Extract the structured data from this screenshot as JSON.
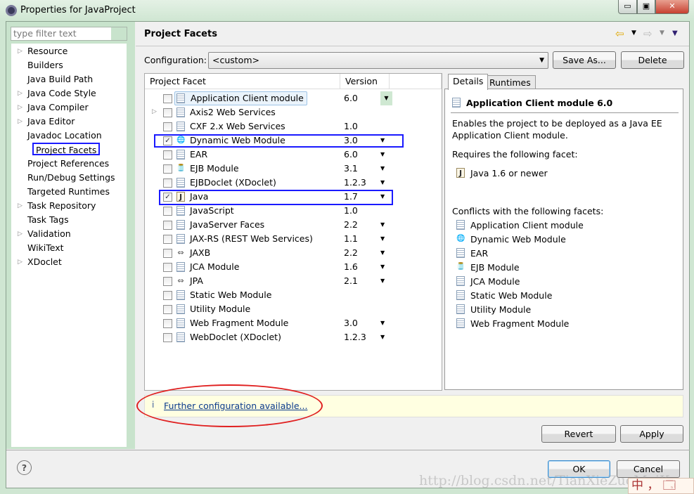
{
  "window": {
    "title": "Properties for JavaProject",
    "minimize": "▭",
    "maximize": "▣",
    "close": "✕"
  },
  "sidebar": {
    "filter_placeholder": "type filter text",
    "items": [
      {
        "label": "Resource",
        "expandable": true
      },
      {
        "label": "Builders",
        "expandable": false
      },
      {
        "label": "Java Build Path",
        "expandable": false
      },
      {
        "label": "Java Code Style",
        "expandable": true
      },
      {
        "label": "Java Compiler",
        "expandable": true
      },
      {
        "label": "Java Editor",
        "expandable": true
      },
      {
        "label": "Javadoc Location",
        "expandable": false
      },
      {
        "label": "Project Facets",
        "expandable": false,
        "selected": true
      },
      {
        "label": "Project References",
        "expandable": false
      },
      {
        "label": "Run/Debug Settings",
        "expandable": false
      },
      {
        "label": "Targeted Runtimes",
        "expandable": false
      },
      {
        "label": "Task Repository",
        "expandable": true
      },
      {
        "label": "Task Tags",
        "expandable": false
      },
      {
        "label": "Validation",
        "expandable": true
      },
      {
        "label": "WikiText",
        "expandable": false
      },
      {
        "label": "XDoclet",
        "expandable": true
      }
    ]
  },
  "page": {
    "title": "Project Facets",
    "config_label": "Configuration:",
    "config_value": "<custom>",
    "save_as": "Save As...",
    "delete": "Delete"
  },
  "table": {
    "headers": [
      "Project Facet",
      "Version"
    ],
    "rows": [
      {
        "name": "Application Client module",
        "version": "6.0",
        "checked": false,
        "icon": "doc",
        "dropdown": true,
        "highlighted": true
      },
      {
        "name": "Axis2 Web Services",
        "version": "",
        "checked": false,
        "icon": "doc",
        "expandable": true
      },
      {
        "name": "CXF 2.x Web Services",
        "version": "1.0",
        "checked": false,
        "icon": "doc"
      },
      {
        "name": "Dynamic Web Module",
        "version": "3.0",
        "checked": true,
        "icon": "globe",
        "dropdown": true
      },
      {
        "name": "EAR",
        "version": "6.0",
        "checked": false,
        "icon": "doc",
        "dropdown": true
      },
      {
        "name": "EJB Module",
        "version": "3.1",
        "checked": false,
        "icon": "jar",
        "dropdown": true
      },
      {
        "name": "EJBDoclet (XDoclet)",
        "version": "1.2.3",
        "checked": false,
        "icon": "doc",
        "dropdown": true
      },
      {
        "name": "Java",
        "version": "1.7",
        "checked": true,
        "icon": "java",
        "dropdown": true
      },
      {
        "name": "JavaScript",
        "version": "1.0",
        "checked": false,
        "icon": "doc"
      },
      {
        "name": "JavaServer Faces",
        "version": "2.2",
        "checked": false,
        "icon": "doc",
        "dropdown": true
      },
      {
        "name": "JAX-RS (REST Web Services)",
        "version": "1.1",
        "checked": false,
        "icon": "doc",
        "dropdown": true
      },
      {
        "name": "JAXB",
        "version": "2.2",
        "checked": false,
        "icon": "arrows",
        "dropdown": true
      },
      {
        "name": "JCA Module",
        "version": "1.6",
        "checked": false,
        "icon": "doc",
        "dropdown": true
      },
      {
        "name": "JPA",
        "version": "2.1",
        "checked": false,
        "icon": "arrows",
        "dropdown": true
      },
      {
        "name": "Static Web Module",
        "version": "",
        "checked": false,
        "icon": "doc"
      },
      {
        "name": "Utility Module",
        "version": "",
        "checked": false,
        "icon": "doc"
      },
      {
        "name": "Web Fragment Module",
        "version": "3.0",
        "checked": false,
        "icon": "doc",
        "dropdown": true
      },
      {
        "name": "WebDoclet (XDoclet)",
        "version": "1.2.3",
        "checked": false,
        "icon": "doc",
        "dropdown": true
      }
    ]
  },
  "details": {
    "tabs": [
      "Details",
      "Runtimes"
    ],
    "title": "Application Client module 6.0",
    "description_1": "Enables the project to be deployed as a Java EE",
    "description_2": "Application Client module.",
    "requires_label": "Requires the following facet:",
    "requires": [
      {
        "name": "Java 1.6 or newer",
        "icon": "java"
      }
    ],
    "conflicts_label": "Conflicts with the following facets:",
    "conflicts": [
      {
        "name": "Application Client module",
        "icon": "doc"
      },
      {
        "name": "Dynamic Web Module",
        "icon": "globe"
      },
      {
        "name": "EAR",
        "icon": "doc"
      },
      {
        "name": "EJB Module",
        "icon": "jar"
      },
      {
        "name": "JCA Module",
        "icon": "doc"
      },
      {
        "name": "Static Web Module",
        "icon": "doc"
      },
      {
        "name": "Utility Module",
        "icon": "doc"
      },
      {
        "name": "Web Fragment Module",
        "icon": "doc"
      }
    ]
  },
  "info": {
    "icon": "i",
    "link": "Further configuration available..."
  },
  "buttons": {
    "revert": "Revert",
    "apply": "Apply",
    "ok": "OK",
    "cancel": "Cancel",
    "help": "?"
  },
  "watermark": "http://blog.csdn.net/TianXieZuoMaiKong",
  "ime": "中 ， 🗔",
  "colors": {
    "annotation_blue": "#1a1aff",
    "annotation_red": "#e02020",
    "info_bg": "#ffffe1",
    "link": "#0b3a8c"
  }
}
